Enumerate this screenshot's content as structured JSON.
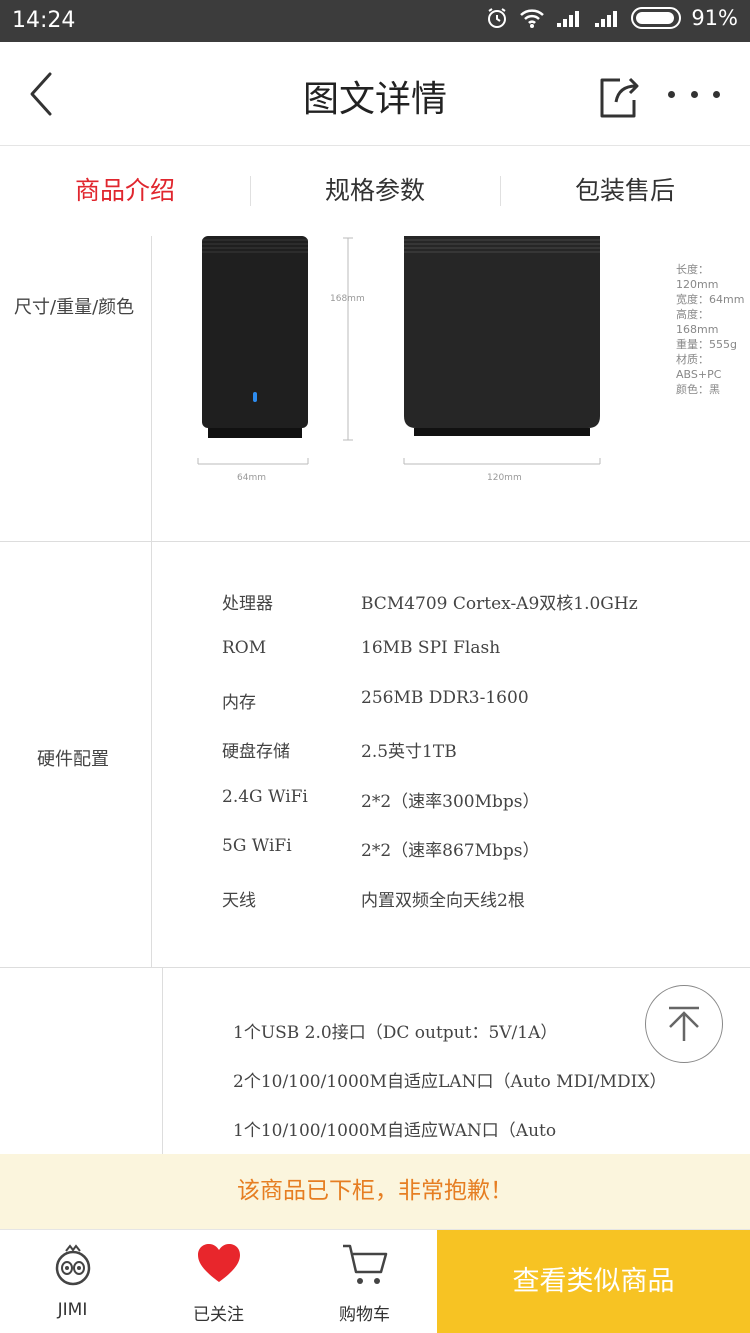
{
  "status_bar": {
    "time": "14:24",
    "battery": "91%"
  },
  "nav": {
    "title": "图文详情"
  },
  "tabs": [
    {
      "label": "商品介绍",
      "active": true
    },
    {
      "label": "规格参数",
      "active": false
    },
    {
      "label": "包装售后",
      "active": false
    }
  ],
  "section1": {
    "label": "尺寸/重量/颜色",
    "dims": {
      "height": "168mm",
      "width_small": "64mm",
      "width_large": "120mm"
    },
    "side_spec": [
      "长度：120mm",
      "宽度：64mm",
      "高度：168mm",
      "重量：555g",
      "材质：ABS+PC",
      "颜色：黑"
    ]
  },
  "section2": {
    "label": "硬件配置",
    "rows": [
      {
        "key": "处理器",
        "value": "BCM4709 Cortex-A9双核1.0GHz"
      },
      {
        "key": "ROM",
        "value": "16MB SPI Flash"
      },
      {
        "key": "内存",
        "value": "256MB DDR3-1600"
      },
      {
        "key": "硬盘存储",
        "value": "2.5英寸1TB"
      },
      {
        "key": "2.4G WiFi",
        "value": "2*2（速率300Mbps）"
      },
      {
        "key": "5G WiFi",
        "value": "2*2（速率867Mbps）"
      },
      {
        "key": "天线",
        "value": "内置双频全向天线2根"
      }
    ]
  },
  "section3": {
    "lines": [
      "1个USB 2.0接口（DC output：5V/1A）",
      "2个10/100/1000M自适应LAN口（Auto MDI/MDIX）",
      "1个10/100/1000M自适应WAN口（Auto"
    ]
  },
  "notice": "该商品已下柜，非常抱歉！",
  "bottom_bar": {
    "items": [
      {
        "label": "JIMI",
        "icon": "jimi-robot-icon"
      },
      {
        "label": "已关注",
        "icon": "heart-icon"
      },
      {
        "label": "购物车",
        "icon": "cart-icon"
      }
    ],
    "cta": "查看类似商品"
  },
  "colors": {
    "accent_red": "#e0262e",
    "cta_yellow": "#f7c323",
    "notice_bg": "#fbf5dd",
    "notice_text": "#e67e22"
  }
}
